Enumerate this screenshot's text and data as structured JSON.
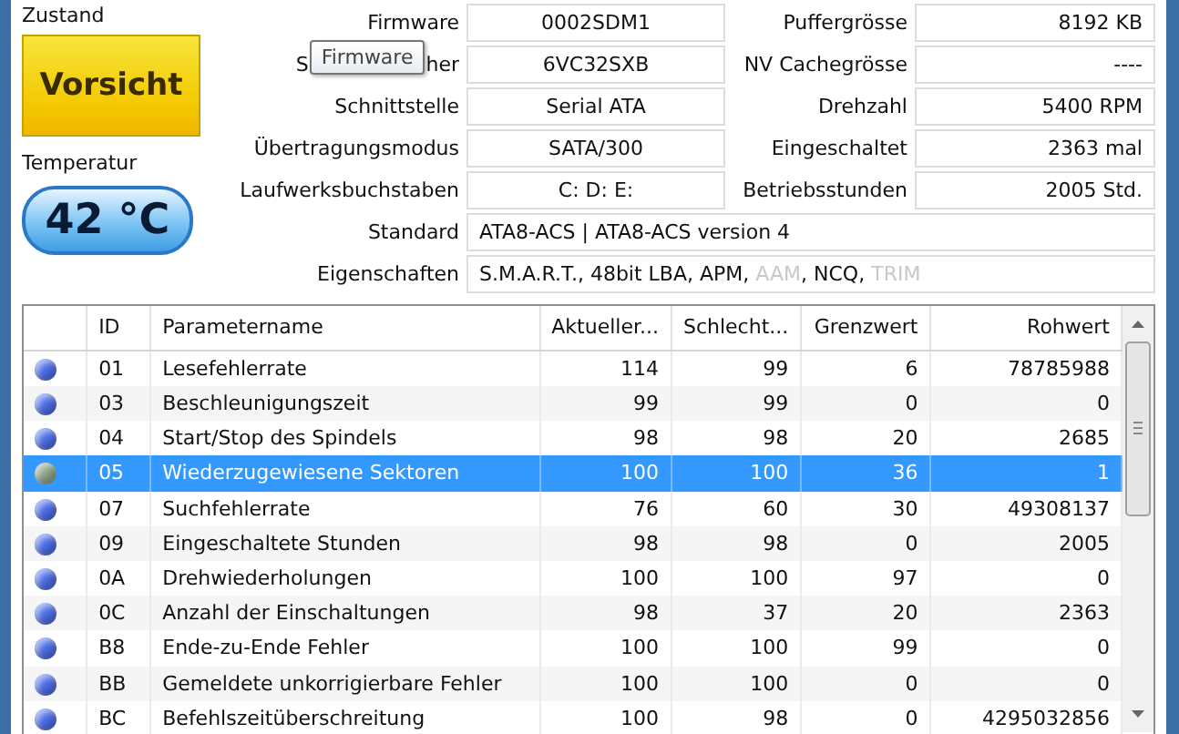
{
  "status": {
    "label": "Zustand",
    "value": "Vorsicht"
  },
  "temperature": {
    "label": "Temperatur",
    "value": "42 °C"
  },
  "info_left": [
    {
      "label": "Firmware",
      "value": "0002SDM1"
    },
    {
      "label_parts": [
        "S",
        "her"
      ],
      "value": "6VC32SXB"
    },
    {
      "label": "Schnittstelle",
      "value": "Serial ATA"
    },
    {
      "label": "Übertragungsmodus",
      "value": "SATA/300"
    },
    {
      "label": "Laufwerksbuchstaben",
      "value": "C: D: E:"
    }
  ],
  "info_right": [
    {
      "label": "Puffergrösse",
      "value": "8192 KB"
    },
    {
      "label": "NV Cachegrösse",
      "value": "----"
    },
    {
      "label": "Drehzahl",
      "value": "5400 RPM"
    },
    {
      "label": "Eingeschaltet",
      "value": "2363 mal"
    },
    {
      "label": "Betriebsstunden",
      "value": "2005 Std."
    }
  ],
  "standard": {
    "label": "Standard",
    "value": "ATA8-ACS | ATA8-ACS version 4"
  },
  "features": {
    "label": "Eigenschaften",
    "items": [
      {
        "label": "S.M.A.R.T.",
        "enabled": true,
        "separator": ", "
      },
      {
        "label": "48bit LBA",
        "enabled": true,
        "separator": ", "
      },
      {
        "label": "APM",
        "enabled": true,
        "separator": ", "
      },
      {
        "label": "AAM",
        "enabled": false,
        "separator": ", "
      },
      {
        "label": "NCQ",
        "enabled": true,
        "separator": ", "
      },
      {
        "label": "TRIM",
        "enabled": false
      }
    ]
  },
  "tooltip": "Firmware",
  "table": {
    "columns": [
      "ID",
      "Parametername",
      "Aktueller...",
      "Schlecht...",
      "Grenzwert",
      "Rohwert"
    ],
    "rows": [
      {
        "color": "#4f6fe8",
        "selected": false,
        "cells": [
          "01",
          "Lesefehlerrate",
          "114",
          "99",
          "6",
          "78785988"
        ]
      },
      {
        "color": "#4f6fe8",
        "selected": false,
        "cells": [
          "03",
          "Beschleunigungszeit",
          "99",
          "99",
          "0",
          "0"
        ]
      },
      {
        "color": "#4f6fe8",
        "selected": false,
        "cells": [
          "04",
          "Start/Stop des Spindels",
          "98",
          "98",
          "20",
          "2685"
        ]
      },
      {
        "color": "#8fa58a",
        "selected": true,
        "cells": [
          "05",
          "Wiederzugewiesene Sektoren",
          "100",
          "100",
          "36",
          "1"
        ]
      },
      {
        "color": "#4f6fe8",
        "selected": false,
        "cells": [
          "07",
          "Suchfehlerrate",
          "76",
          "60",
          "30",
          "49308137"
        ]
      },
      {
        "color": "#4f6fe8",
        "selected": false,
        "cells": [
          "09",
          "Eingeschaltete Stunden",
          "98",
          "98",
          "0",
          "2005"
        ]
      },
      {
        "color": "#4f6fe8",
        "selected": false,
        "cells": [
          "0A",
          "Drehwiederholungen",
          "100",
          "100",
          "97",
          "0"
        ]
      },
      {
        "color": "#4f6fe8",
        "selected": false,
        "cells": [
          "0C",
          "Anzahl der Einschaltungen",
          "98",
          "37",
          "20",
          "2363"
        ]
      },
      {
        "color": "#4f6fe8",
        "selected": false,
        "cells": [
          "B8",
          "Ende-zu-Ende Fehler",
          "100",
          "100",
          "99",
          "0"
        ]
      },
      {
        "color": "#4f6fe8",
        "selected": false,
        "cells": [
          "BB",
          "Gemeldete unkorrigierbare Fehler",
          "100",
          "100",
          "0",
          "0"
        ]
      },
      {
        "color": "#4f6fe8",
        "selected": false,
        "cells": [
          "BC",
          "Befehlszeitüberschreitung",
          "100",
          "98",
          "0",
          "4295032856"
        ]
      }
    ]
  }
}
